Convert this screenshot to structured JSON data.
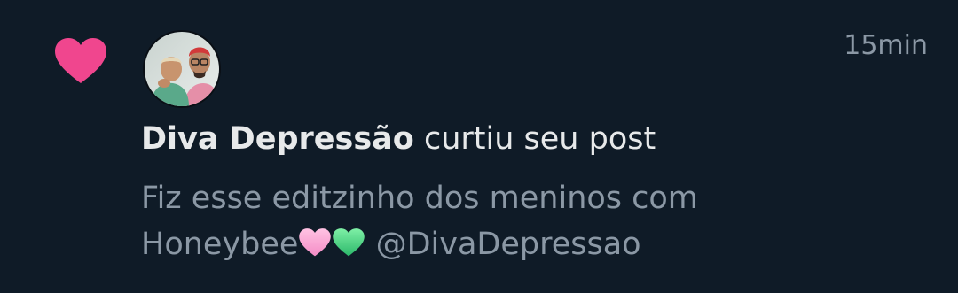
{
  "notification": {
    "type_icon": "heart-icon",
    "type_icon_color": "#f91880",
    "time": "15min",
    "user_name": "Diva Depressão",
    "action_text": " curtiu seu post",
    "post_line1": "Fiz esse editzinho dos meninos com",
    "post_line2_start": "Honeybee",
    "post_emojis": [
      "pink-heart-icon",
      "green-heart-icon"
    ],
    "post_mention": " @DivaDepressao"
  },
  "colors": {
    "background": "#0f1b27",
    "primary_text": "#e7e9ea",
    "secondary_text": "#8b98a5",
    "like_pink": "#f91880"
  }
}
